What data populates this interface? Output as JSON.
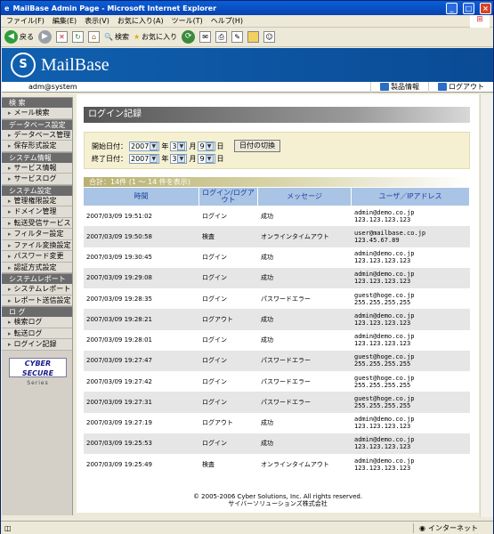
{
  "window": {
    "title": "MailBase Admin Page - Microsoft Internet Explorer"
  },
  "menu": [
    "ファイル(F)",
    "編集(E)",
    "表示(V)",
    "お気に入り(A)",
    "ツール(T)",
    "ヘルプ(H)"
  ],
  "toolbar": {
    "back": "戻る",
    "search": "検索",
    "favorites": "お気に入り"
  },
  "brand": {
    "name": "MailBase"
  },
  "userbar": {
    "user": "adm@system",
    "product_info": "製品情報",
    "logout": "ログアウト"
  },
  "sidebar": [
    {
      "section": "検 索",
      "items": [
        "メール検索"
      ]
    },
    {
      "section": "データベース設定",
      "items": [
        "データベース管理",
        "保存形式設定"
      ]
    },
    {
      "section": "システム情報",
      "items": [
        "サービス情報",
        "サービスログ"
      ]
    },
    {
      "section": "システム設定",
      "items": [
        "管理権限設定",
        "ドメイン管理",
        "転送受信サービス",
        "フィルター設定",
        "ファイル変換設定",
        "パスワード変更",
        "認証方式設定"
      ]
    },
    {
      "section": "システムレポート",
      "items": [
        "システムレポート",
        "レポート送信設定"
      ]
    },
    {
      "section": "ロ グ",
      "items": [
        "検索ログ",
        "転送ログ",
        "ログイン記録"
      ]
    }
  ],
  "cyber_logo": {
    "title": "CYBER SECURE",
    "sub": "Series"
  },
  "page": {
    "title": "ログイン記録",
    "start_label": "開始日付：",
    "end_label": "終了日付：",
    "year": "2007",
    "month": "3",
    "day": "9",
    "year_unit": "年",
    "month_unit": "月",
    "day_unit": "日",
    "switch_button": "日付の切換",
    "count_text": "合計：14件 (1 ～ 14 件を表示)"
  },
  "table": {
    "headers": [
      "時間",
      "ログイン/ログアウト",
      "メッセージ",
      "ユーザ／IPアドレス"
    ],
    "rows": [
      {
        "time": "2007/03/09 19:51:02",
        "type": "ログイン",
        "msg": "成功",
        "user": "admin@demo.co.jp",
        "ip": "123.123.123.123"
      },
      {
        "time": "2007/03/09 19:50:58",
        "type": "検査",
        "msg": "オンラインタイムアウト",
        "user": "user@mailbase.co.jp",
        "ip": "123.45.67.89"
      },
      {
        "time": "2007/03/09 19:30:45",
        "type": "ログイン",
        "msg": "成功",
        "user": "admin@demo.co.jp",
        "ip": "123.123.123.123"
      },
      {
        "time": "2007/03/09 19:29:08",
        "type": "ログイン",
        "msg": "成功",
        "user": "admin@demo.co.jp",
        "ip": "123.123.123.123"
      },
      {
        "time": "2007/03/09 19:28:35",
        "type": "ログイン",
        "msg": "パスワードエラー",
        "user": "guest@hoge.co.jp",
        "ip": "255.255.255.255"
      },
      {
        "time": "2007/03/09 19:28:21",
        "type": "ログアウト",
        "msg": "成功",
        "user": "admin@demo.co.jp",
        "ip": "123.123.123.123"
      },
      {
        "time": "2007/03/09 19:28:01",
        "type": "ログイン",
        "msg": "成功",
        "user": "admin@demo.co.jp",
        "ip": "123.123.123.123"
      },
      {
        "time": "2007/03/09 19:27:47",
        "type": "ログイン",
        "msg": "パスワードエラー",
        "user": "guest@hoge.co.jp",
        "ip": "255.255.255.255"
      },
      {
        "time": "2007/03/09 19:27:42",
        "type": "ログイン",
        "msg": "パスワードエラー",
        "user": "guest@hoge.co.jp",
        "ip": "255.255.255.255"
      },
      {
        "time": "2007/03/09 19:27:31",
        "type": "ログイン",
        "msg": "パスワードエラー",
        "user": "guest@hoge.co.jp",
        "ip": "255.255.255.255"
      },
      {
        "time": "2007/03/09 19:27:19",
        "type": "ログアウト",
        "msg": "成功",
        "user": "admin@demo.co.jp",
        "ip": "123.123.123.123"
      },
      {
        "time": "2007/03/09 19:25:53",
        "type": "ログイン",
        "msg": "成功",
        "user": "admin@demo.co.jp",
        "ip": "123.123.123.123"
      },
      {
        "time": "2007/03/09 19:25:49",
        "type": "検査",
        "msg": "オンラインタイムアウト",
        "user": "admin@demo.co.jp",
        "ip": "123.123.123.123"
      }
    ]
  },
  "footer": {
    "line1": "© 2005-2006 Cyber Solutions, Inc. All rights reserved.",
    "line2": "サイバーソリューションズ株式会社"
  },
  "status": {
    "zone": "インターネット"
  }
}
